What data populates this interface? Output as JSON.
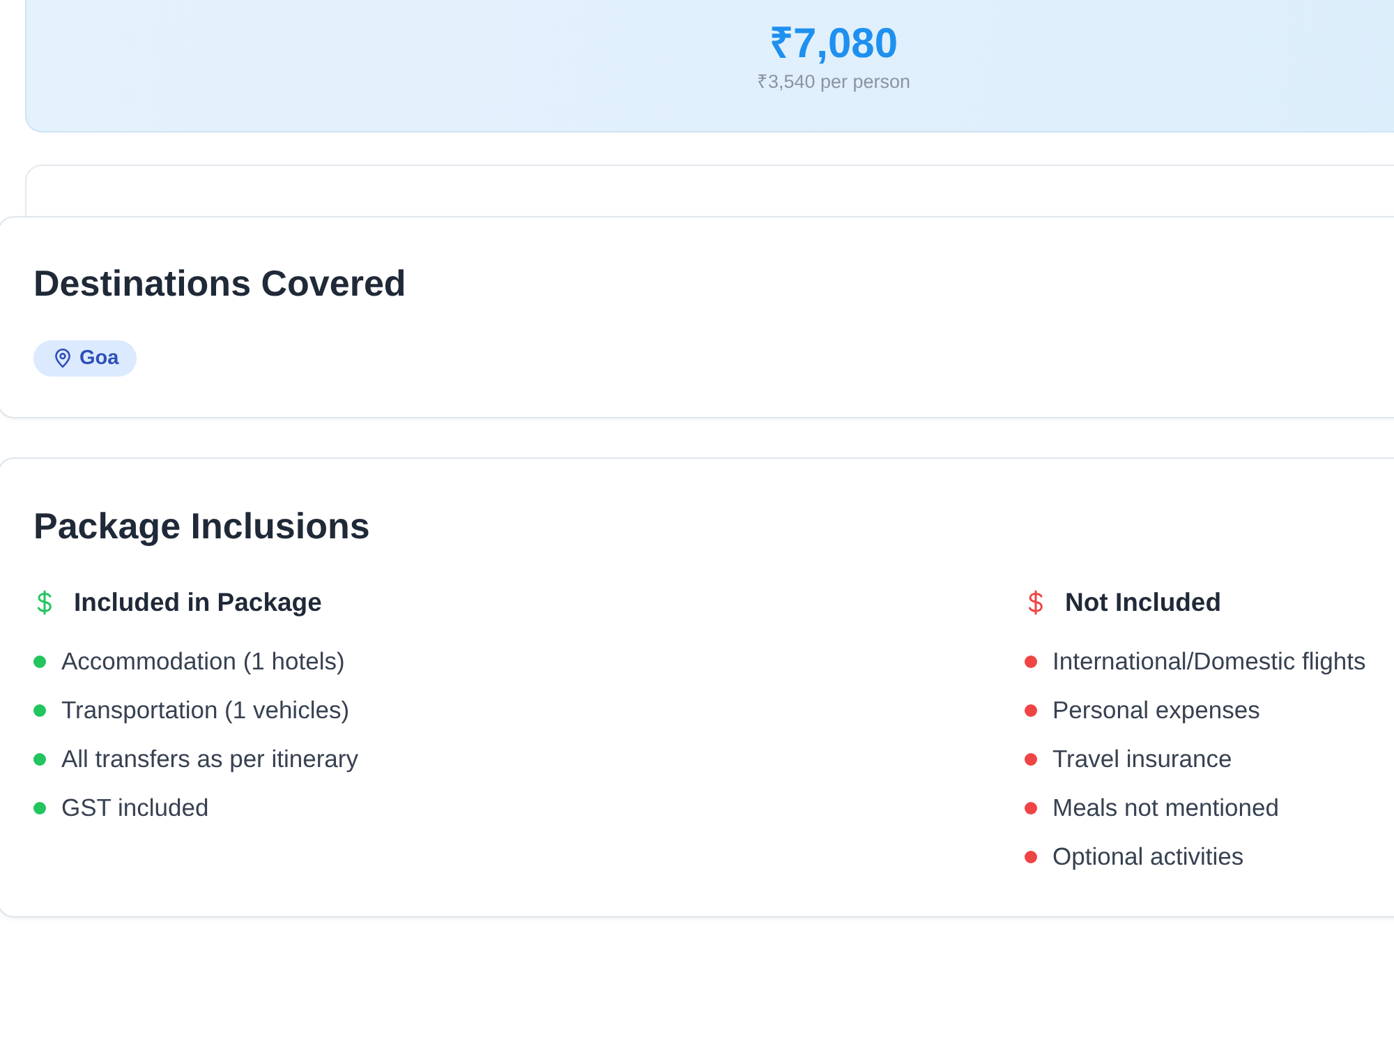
{
  "price_card": {
    "total": "₹7,080",
    "per_person": "₹3,540 per person"
  },
  "destinations": {
    "title": "Destinations Covered",
    "tags": [
      {
        "label": "Goa"
      }
    ]
  },
  "inclusions": {
    "title": "Package Inclusions",
    "groups": [
      {
        "title": "Included in Package",
        "color": "#22c55e",
        "items": [
          "Accommodation (1 hotels)",
          "Transportation (1 vehicles)",
          "All transfers as per itinerary",
          "GST included"
        ]
      },
      {
        "title": "Not Included",
        "color": "#ef4444",
        "items": [
          "International/Domestic flights",
          "Personal expenses",
          "Travel insurance",
          "Meals not mentioned",
          "Optional activities"
        ]
      }
    ]
  }
}
